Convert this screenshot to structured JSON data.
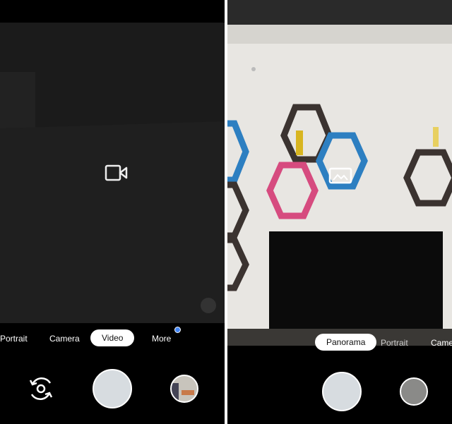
{
  "left": {
    "modes": [
      "Portrait",
      "Camera",
      "Video",
      "More"
    ],
    "active_mode": "Video",
    "indicator_color": "#4285f4",
    "center_icon": "video-camera-icon"
  },
  "right": {
    "modes": [
      "Panorama",
      "Portrait",
      "Came"
    ],
    "active_mode": "Panorama",
    "center_icon": "panorama-icon"
  }
}
